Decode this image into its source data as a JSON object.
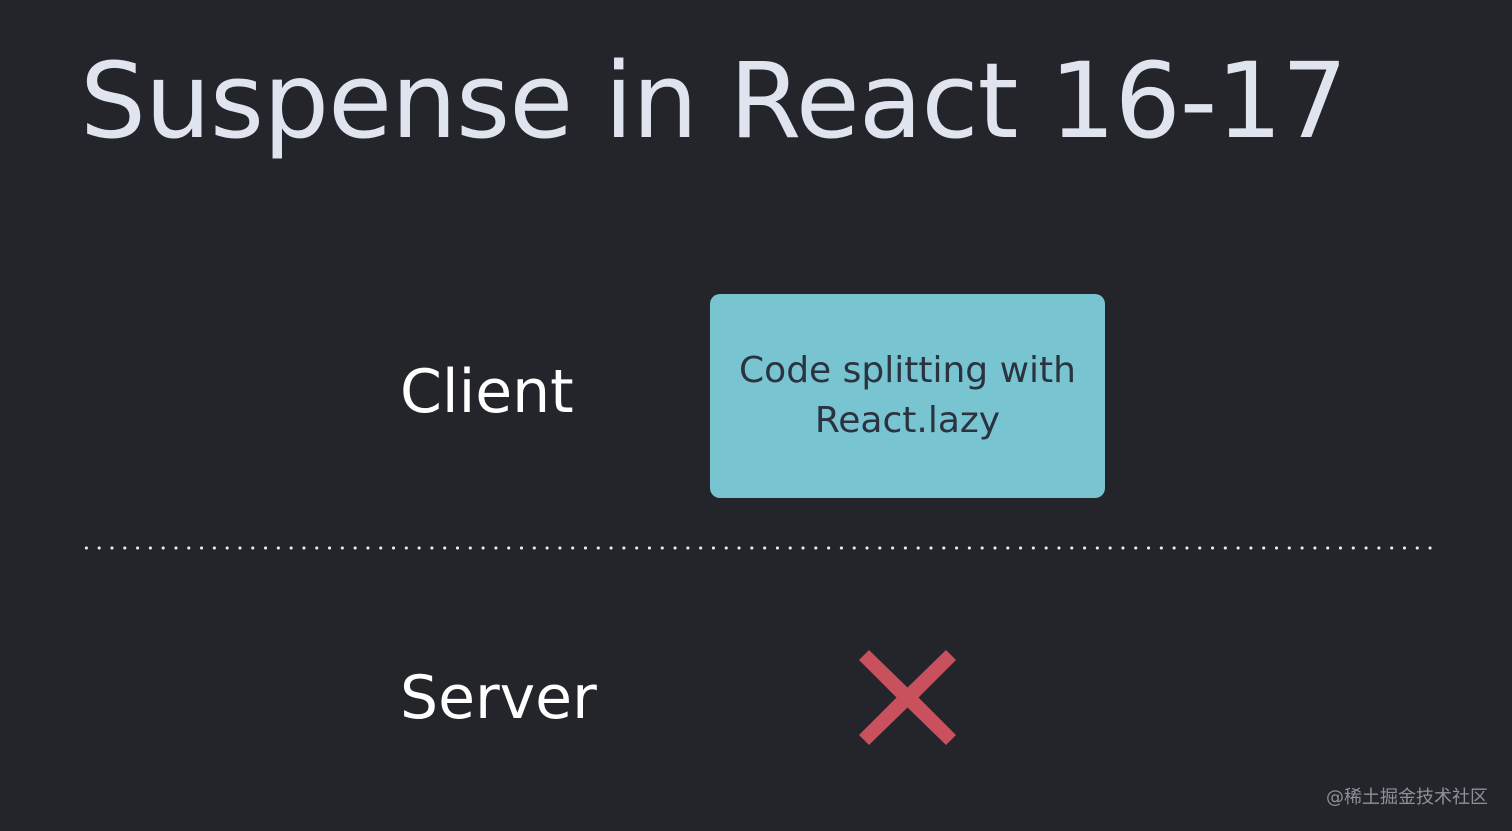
{
  "slide": {
    "title": "Suspense in React 16-17",
    "rows": {
      "client": {
        "label": "Client",
        "feature": "Code splitting with React.lazy"
      },
      "server": {
        "label": "Server",
        "status_icon": "x-icon"
      }
    },
    "watermark": "@稀土掘金技术社区"
  },
  "colors": {
    "background": "#23252b",
    "title": "#dfe4ee",
    "label": "#ffffff",
    "feature_box": "#79c4d1",
    "feature_text": "#2c3340",
    "divider": "#e7eaf0",
    "x_mark": "#c9505d",
    "watermark": "#8d9199"
  }
}
